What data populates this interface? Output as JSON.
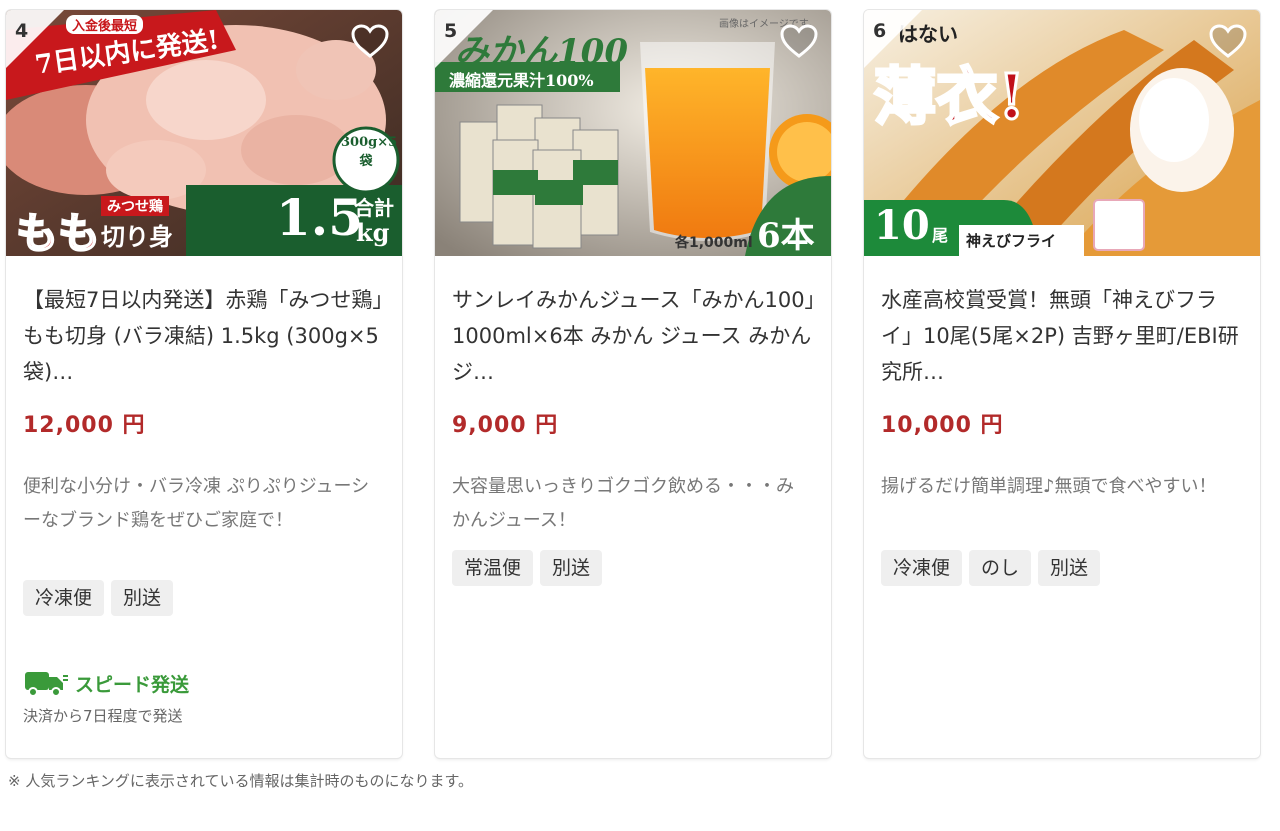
{
  "products": [
    {
      "rank": "4",
      "image_texts": {
        "banner_small": "入金後最短",
        "banner": "7日以内に発送!",
        "pack": "300g×5袋",
        "total_label": "合計",
        "total": "1.5",
        "unit": "kg",
        "brand": "みつせ鶏",
        "cut": "もも",
        "cut2": "切り身"
      },
      "title": "【最短7日以内発送】赤鶏「みつせ鶏」もも切身 (バラ凍結) 1.5kg (300g×5袋)…",
      "price": "12,000 円",
      "description": "便利な小分け・バラ冷凍 ぷりぷりジューシーなブランド鶏をぜひご家庭で！",
      "tags": [
        "冷凍便",
        "別送"
      ],
      "speed_label": "スピード発送",
      "speed_note": "決済から7日程度で発送"
    },
    {
      "rank": "5",
      "image_texts": {
        "note": "画像はイメージです。",
        "logo": "みかん100",
        "sub": "濃縮還元果汁100%",
        "each": "各1,000ml",
        "count": "6本"
      },
      "title": "サンレイみかんジュース「みかん100」1000ml×6本 みかん ジュース みかんジ…",
      "price": "9,000 円",
      "description": "大容量思いっきりゴクゴク飲める・・・みかんジュース！",
      "tags": [
        "常温便",
        "別送"
      ]
    },
    {
      "rank": "6",
      "image_texts": {
        "top": "はない",
        "big": "薄衣!",
        "count": "10",
        "count_unit": "尾",
        "brand": "神えびフライ"
      },
      "title": "水産高校賞受賞！無頭「神えびフライ」10尾(5尾×2P) 吉野ヶ里町/EBI研究所…",
      "price": "10,000 円",
      "description": "揚げるだけ簡単調理♪無頭で食べやすい！",
      "tags": [
        "冷凍便",
        "のし",
        "別送"
      ]
    }
  ],
  "footnote": "※ 人気ランキングに表示されている情報は集計時のものになります。",
  "colors": {
    "price": "#b22a2a",
    "speed": "#3a9a3a",
    "tag_bg": "#efefef"
  }
}
